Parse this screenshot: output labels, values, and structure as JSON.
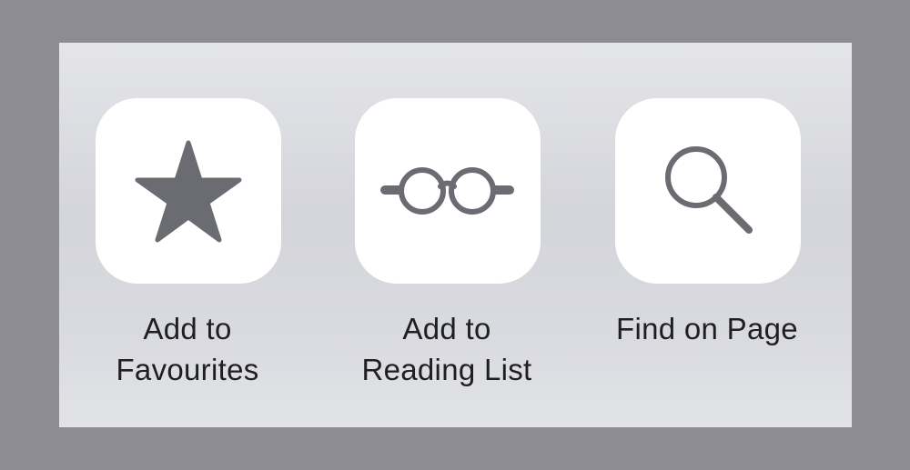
{
  "colors": {
    "backdrop": "#8d8c93",
    "sheet": "#dddee2",
    "tile": "#ffffff",
    "icon": "#6b6b72",
    "text": "#1f1f22"
  },
  "actions": [
    {
      "icon": "star-icon",
      "label_line1": "Add to",
      "label_line2": "Favourites"
    },
    {
      "icon": "glasses-icon",
      "label_line1": "Add to",
      "label_line2": "Reading List"
    },
    {
      "icon": "magnifier-icon",
      "label_line1": "Find on Page",
      "label_line2": ""
    }
  ]
}
